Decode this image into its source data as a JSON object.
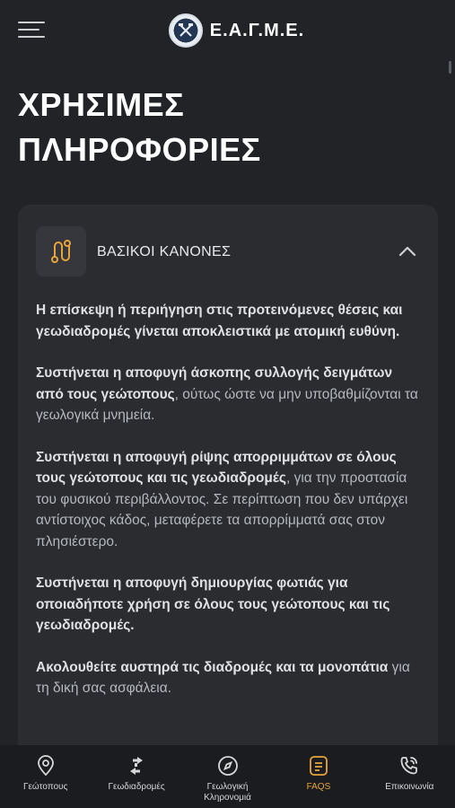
{
  "header": {
    "brand": "Ε.Α.Γ.Μ.Ε.",
    "menu_icon": "hamburger-menu-icon",
    "logo_icon": "eagme-logo-icon"
  },
  "page": {
    "title": "ΧΡΗΣΙΜΕΣ ΠΛΗΡΟΦΟΡΙΕΣ"
  },
  "accordion": {
    "icon": "route-icon",
    "title": "ΒΑΣΙΚΟΙ ΚΑΝΟΝΕΣ",
    "toggle_icon": "chevron-up-icon",
    "paragraphs": [
      {
        "bold": "Η επίσκεψη ή περιήγηση στις προτεινόμενες θέσεις και γεωδιαδρομές γίνεται αποκλειστικά με ατομική ευθύνη.",
        "normal": ""
      },
      {
        "bold": "Συστήνεται η αποφυγή άσκοπης συλλογής δειγμάτων από τους γεώτοπους",
        "normal": ", ούτως ώστε να μην υποβαθμίζονται τα γεωλογικά μνημεία."
      },
      {
        "bold": "Συστήνεται η αποφυγή ρίψης απορριμμάτων σε όλους τους γεώτοπους και τις γεωδιαδρομές",
        "normal": ", για την προστασία του φυσικού περιβάλλοντος. Σε περίπτωση που δεν υπάρχει αντίστοιχος κάδος, μεταφέρετε τα απορρίμματά σας στον πλησιέστερο."
      },
      {
        "bold": "Συστήνεται η αποφυγή δημιουργίας φωτιάς για οποιαδήποτε χρήση σε όλους τους γεώτοπους και τις γεωδιαδρομές.",
        "normal": ""
      },
      {
        "bold": "Ακολουθείτε αυστηρά τις διαδρομές και τα μονοπάτια",
        "normal": " για τη δική σας ασφάλεια."
      }
    ]
  },
  "nav": {
    "items": [
      {
        "label": "Γεώτοπους",
        "icon": "location-pin-icon"
      },
      {
        "label": "Γεωδιαδρομές",
        "icon": "directions-icon"
      },
      {
        "label": "Γεωλογική Κληρονομιά",
        "icon": "compass-icon"
      },
      {
        "label": "FAQS",
        "icon": "faq-document-icon"
      },
      {
        "label": "Επικοινωνία",
        "icon": "phone-icon"
      }
    ],
    "active": "FAQS"
  },
  "colors": {
    "background": "#212327",
    "card": "#2a2c30",
    "accent": "#e8a43a",
    "nav_background": "#1b1c20"
  }
}
